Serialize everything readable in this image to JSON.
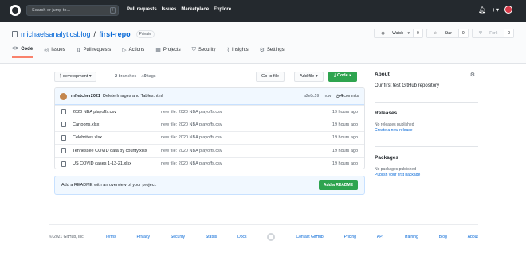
{
  "header": {
    "search_placeholder": "Search or jump to...",
    "search_shortcut": "/",
    "nav": [
      "Pull requests",
      "Issues",
      "Marketplace",
      "Explore"
    ],
    "icons": [
      "bell-icon",
      "plus-icon",
      "avatar"
    ]
  },
  "repo": {
    "owner": "michaelsanalyticsblog",
    "separator": "/",
    "name": "first-repo",
    "visibility": "Private",
    "watch_label": "Watch",
    "watch_count": "0",
    "star_label": "Star",
    "star_count": "0",
    "fork_label": "Fork",
    "fork_count": "0",
    "tabs": [
      {
        "label": "Code",
        "active": true
      },
      {
        "label": "Issues"
      },
      {
        "label": "Pull requests"
      },
      {
        "label": "Actions"
      },
      {
        "label": "Projects"
      },
      {
        "label": "Security"
      },
      {
        "label": "Insights"
      },
      {
        "label": "Settings"
      }
    ]
  },
  "toolbar": {
    "branch": "development",
    "branches": "2",
    "branches_label": "branches",
    "tags": "0",
    "tags_label": "tags",
    "goto_file": "Go to file",
    "add_file": "Add file",
    "code": "Code"
  },
  "commit": {
    "author": "mfletcher2021",
    "message": "Delete Images and Tables.html",
    "hash": "a2e8c59",
    "time": "now",
    "count": "4",
    "count_label": "commits"
  },
  "files": [
    {
      "name": "2020 NBA playoffs.csv",
      "message": "new file: 2020 NBA playoffs.csv",
      "age": "19 hours ago"
    },
    {
      "name": "Cartoons.xlsx",
      "message": "new file: 2020 NBA playoffs.csv",
      "age": "19 hours ago"
    },
    {
      "name": "Celebrities.xlsx",
      "message": "new file: 2020 NBA playoffs.csv",
      "age": "19 hours ago"
    },
    {
      "name": "Tennessee COVID data by county.xlsx",
      "message": "new file: 2020 NBA playoffs.csv",
      "age": "19 hours ago"
    },
    {
      "name": "US COVID cases 1-13-21.xlsx",
      "message": "new file: 2020 NBA playoffs.csv",
      "age": "19 hours ago"
    }
  ],
  "readme": {
    "text": "Add a README with an overview of your project.",
    "button": "Add a README"
  },
  "sidebar": {
    "about_title": "About",
    "about_desc": "Our first test GitHub repository",
    "releases_title": "Releases",
    "releases_text": "No releases published",
    "releases_link": "Create a new release",
    "packages_title": "Packages",
    "packages_text": "No packages published",
    "packages_link": "Publish your first package"
  },
  "footer": {
    "copyright": "© 2021 GitHub, Inc.",
    "links_left": [
      "Terms",
      "Privacy",
      "Security",
      "Status",
      "Docs"
    ],
    "links_right": [
      "Contact GitHub",
      "Pricing",
      "API",
      "Training",
      "Blog",
      "About"
    ]
  }
}
